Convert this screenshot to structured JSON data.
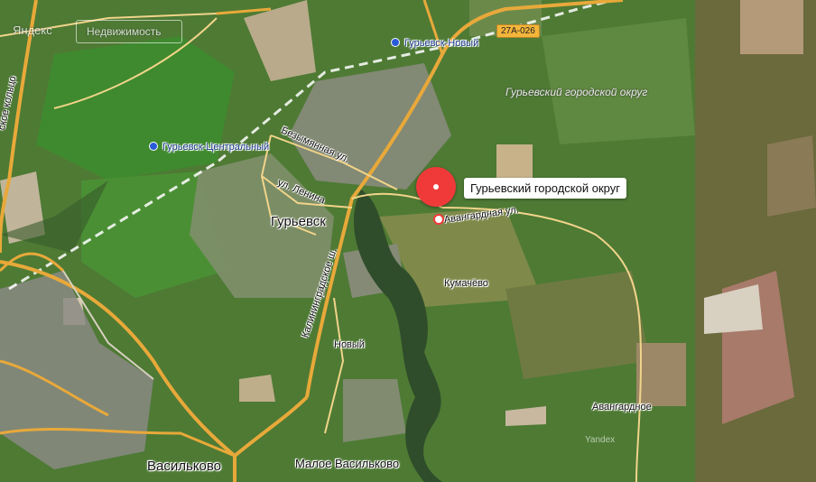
{
  "map": {
    "logo_text": "Яндекс",
    "logo_subtitle": "Недвижимость",
    "watermark": "Yandex",
    "marker": {
      "label": "Гурьевский городской округ"
    },
    "route_badge": "27А-026",
    "stations": [
      {
        "name": "Гурьевск-Новый"
      },
      {
        "name": "Гурьевск-Центральный"
      }
    ],
    "district_label": "Гурьевский городской округ",
    "places": [
      {
        "name": "Гурьевск"
      },
      {
        "name": "Кумачёво"
      },
      {
        "name": "Новый"
      },
      {
        "name": "Авангардное"
      },
      {
        "name": "Васильково"
      },
      {
        "name": "Малое Васильково"
      }
    ],
    "streets": [
      {
        "name": "Безымянная ул."
      },
      {
        "name": "ул. Ленина"
      },
      {
        "name": "Калининградское ш."
      },
      {
        "name": "Авангардная ул."
      },
      {
        "name": "ское кольцо"
      }
    ],
    "colors": {
      "marker": "#f03a3a",
      "road_major": "#e8a93a",
      "station": "#2a5bd7"
    }
  }
}
